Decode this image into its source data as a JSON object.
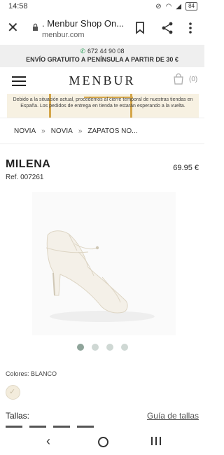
{
  "status": {
    "time": "14:58",
    "battery": "84"
  },
  "browser": {
    "page_title": ". Menbur Shop On...",
    "domain": "menbur.com"
  },
  "promo": {
    "phone": "672 44 90 08",
    "shipping": "ENVÍO GRATUITO A PENÍNSULA A PARTIR DE 30 €"
  },
  "header": {
    "logo": "MENBUR",
    "cart_count": "(0)"
  },
  "notice": {
    "text": "Debido a la situación actual, procedemos al cierre temporal de nuestras tiendas en España. Los pedidos de entrega en tienda te estarán esperando a la vuelta."
  },
  "breadcrumb": {
    "items": [
      "NOVIA",
      "NOVIA",
      "ZAPATOS NO..."
    ],
    "separator": "»"
  },
  "product": {
    "name": "MILENA",
    "price": "69.95 €",
    "ref": "Ref. 007261",
    "gallery_count": 4,
    "gallery_active_index": 0,
    "colors_label": "Colores:",
    "color_value": "BLANCO",
    "color_swatch": "#f3ecdc",
    "sizes_label": "Tallas:",
    "size_guide": "Guía de tallas"
  },
  "icons": {
    "close": "close-icon",
    "lock": "lock-icon",
    "bookmark": "bookmark-icon",
    "share": "share-icon",
    "menu": "more-vert-icon",
    "phone": "phone-icon",
    "hamburger": "hamburger-icon",
    "cart": "shopping-bag-icon",
    "back": "back-icon",
    "home": "home-icon",
    "recents": "recents-icon"
  },
  "colors": {
    "accent_green": "#1d9a4e",
    "promo_bg": "#efefef"
  }
}
